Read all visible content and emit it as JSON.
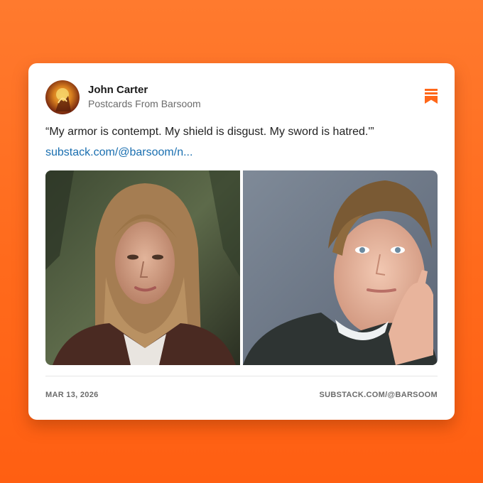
{
  "post": {
    "author": "John Carter",
    "publication": "Postcards From Barsoom",
    "quote": "“My armor is contempt. My shield is disgust. My sword is hatred.'”",
    "link_text": "substack.com/@barsoom/n...",
    "date": "MAR 13, 2026",
    "source": "SUBSTACK.COM/@BARSOOM"
  },
  "icons": {
    "bookmark": "bookmark-icon",
    "avatar": "avatar-illustration"
  },
  "colors": {
    "background": "#ff6a1c",
    "accent": "#ff6719",
    "link": "#1a6fb0"
  },
  "images": [
    {
      "name": "photo-woman-portrait"
    },
    {
      "name": "photo-man-portrait"
    }
  ]
}
